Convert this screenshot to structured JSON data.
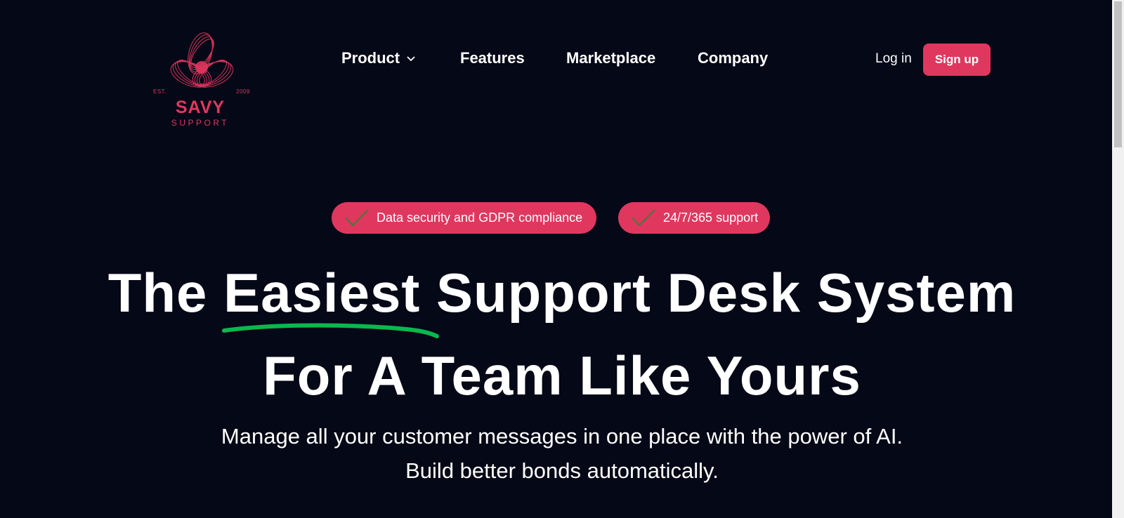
{
  "logo": {
    "est": "EST.",
    "year": "2009",
    "name": "SAVY",
    "sub": "SUPPORT",
    "icon": "triple-loop-logo-icon"
  },
  "nav": {
    "items": [
      {
        "label": "Product",
        "has_dropdown": true
      },
      {
        "label": "Features"
      },
      {
        "label": "Marketplace"
      },
      {
        "label": "Company"
      }
    ],
    "login_label": "Log in",
    "signup_label": "Sign up"
  },
  "badges": [
    {
      "label": "Data security and GDPR compliance",
      "icon": "check-icon"
    },
    {
      "label": "24/7/365 support",
      "icon": "check-icon"
    }
  ],
  "hero": {
    "line1_before": "The ",
    "line1_highlight": "Easiest",
    "line1_after": " Support Desk System",
    "line2": "For A Team Like Yours",
    "subtitle_1": "Manage all your customer messages in one place with the power of AI.",
    "subtitle_2": "Build better bonds automatically."
  },
  "colors": {
    "background": "#050816",
    "accent": "#e0375f",
    "underline": "#0ab84d",
    "check": "#3f7d36"
  }
}
